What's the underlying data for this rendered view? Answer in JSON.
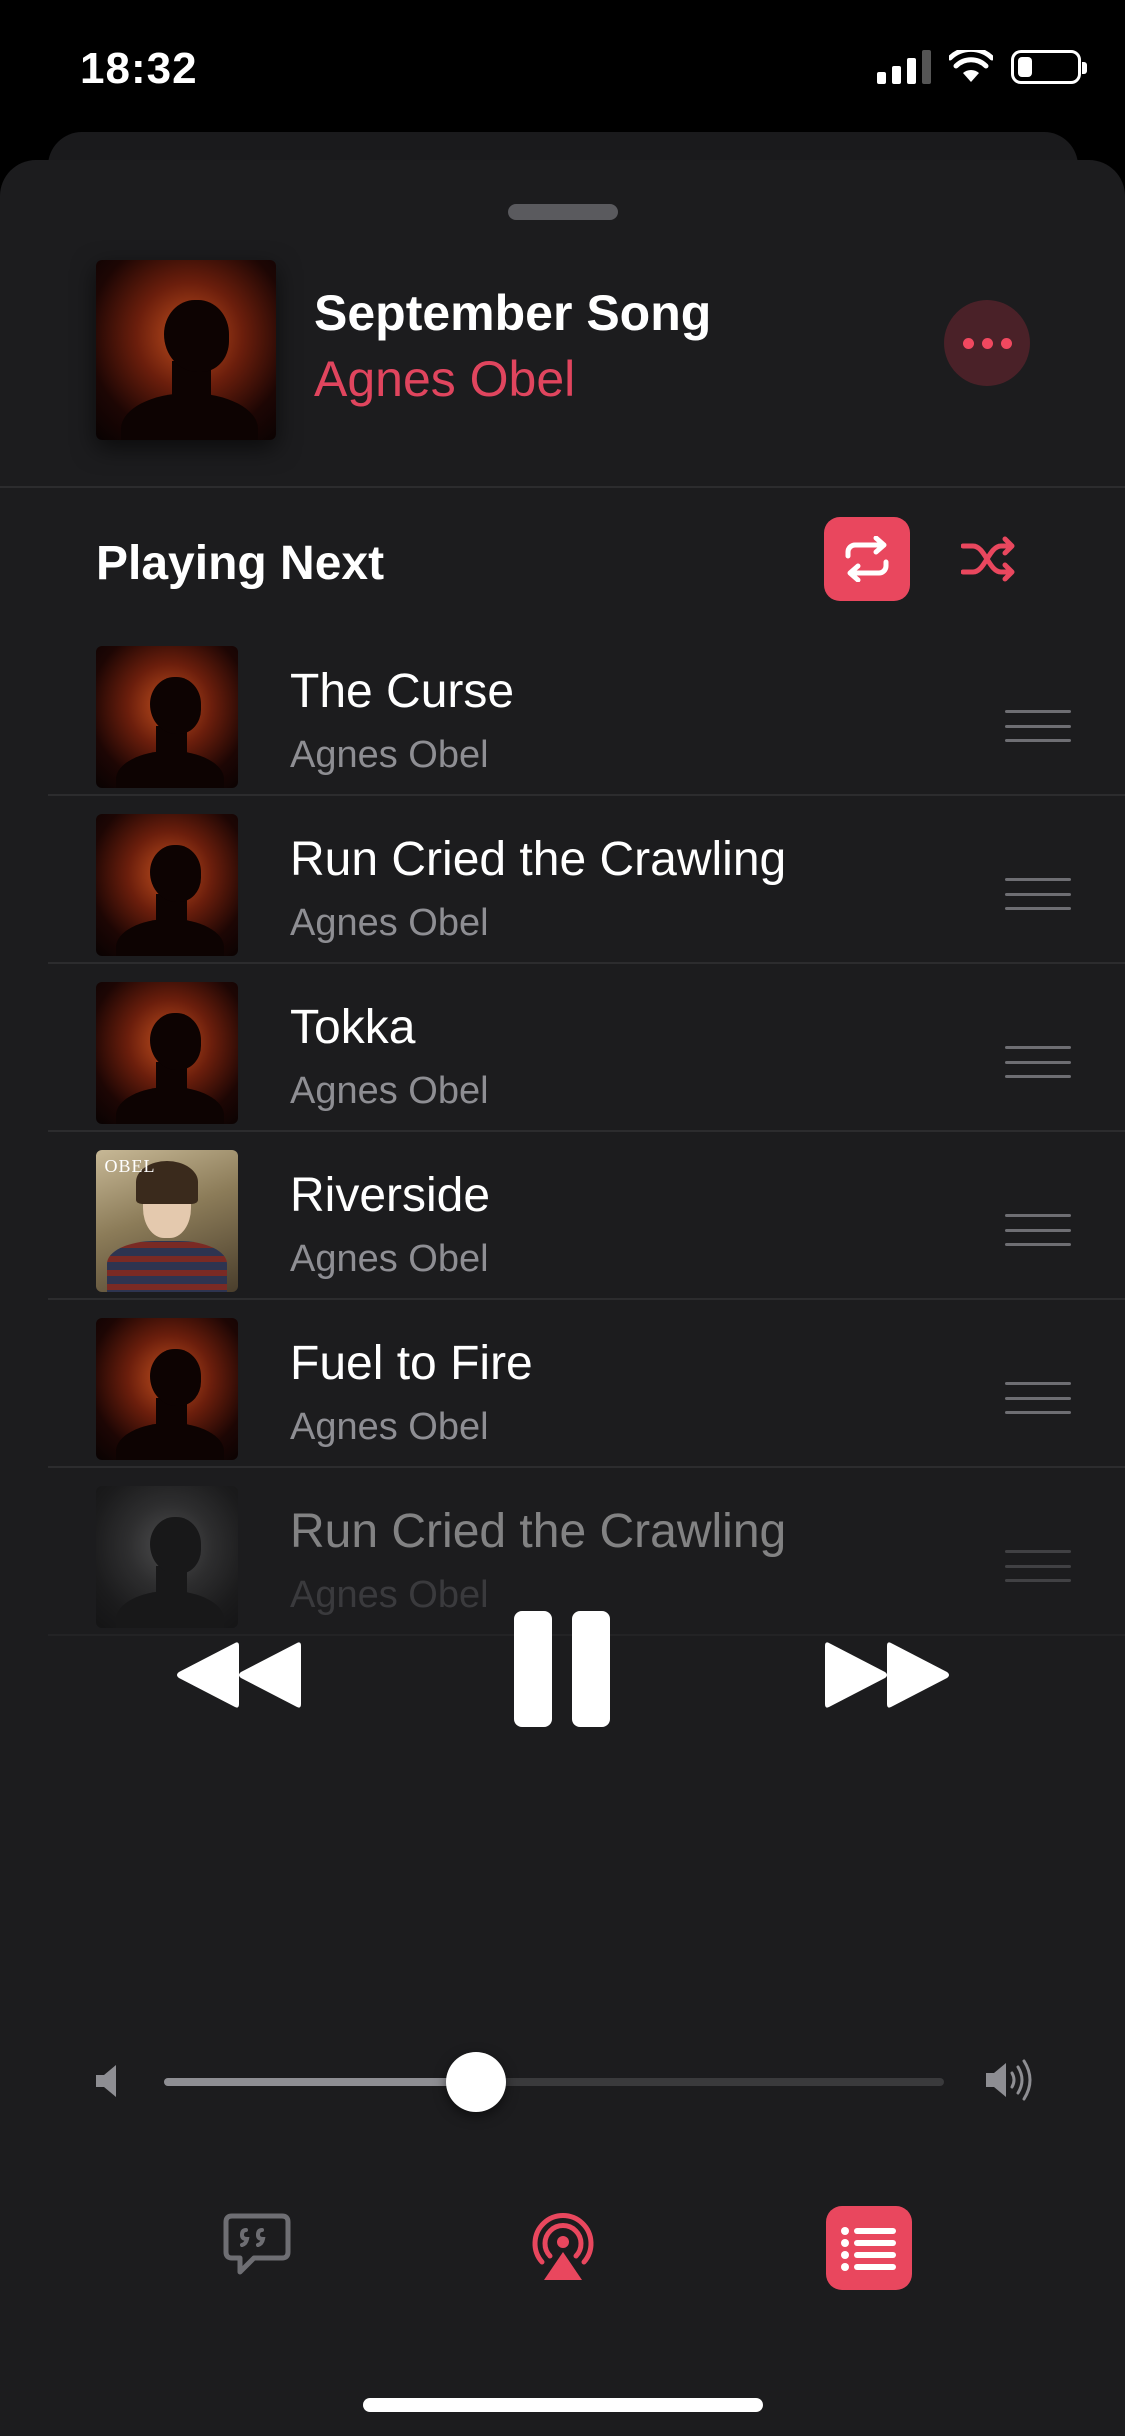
{
  "status_bar": {
    "time": "18:32",
    "icons": [
      "signal-icon",
      "wifi-icon",
      "battery-icon"
    ]
  },
  "now_playing": {
    "title": "September Song",
    "artist": "Agnes Obel",
    "more_icon": "ellipsis-icon"
  },
  "queue_header": {
    "title": "Playing Next",
    "repeat_icon": "repeat-icon",
    "repeat_active": true,
    "shuffle_icon": "shuffle-icon"
  },
  "queue": [
    {
      "title": "The Curse",
      "artist": "Agnes Obel",
      "art": "portrait-orange"
    },
    {
      "title": "Run Cried the Crawling",
      "artist": "Agnes Obel",
      "art": "portrait-orange"
    },
    {
      "title": "Tokka",
      "artist": "Agnes Obel",
      "art": "portrait-orange"
    },
    {
      "title": "Riverside",
      "artist": "Agnes Obel",
      "art": "riverside",
      "art_text": "OBEL"
    },
    {
      "title": "Fuel to Fire",
      "artist": "Agnes Obel",
      "art": "portrait-orange"
    },
    {
      "title": "Run Cried the Crawling",
      "artist": "Agnes Obel",
      "art": "portrait-grey"
    }
  ],
  "transport": {
    "rewind_icon": "rewind-icon",
    "pause_icon": "pause-icon",
    "forward_icon": "fast-forward-icon"
  },
  "volume": {
    "level": 0.4,
    "low_icon": "speaker-low-icon",
    "high_icon": "speaker-high-icon"
  },
  "bottom_bar": {
    "lyrics_icon": "lyrics-icon",
    "airplay_icon": "airplay-icon",
    "queue_icon": "queue-list-icon",
    "queue_active": true
  },
  "colors": {
    "accent": "#e9475e",
    "background": "#1c1c1e",
    "secondary_text": "#8e8e93"
  }
}
